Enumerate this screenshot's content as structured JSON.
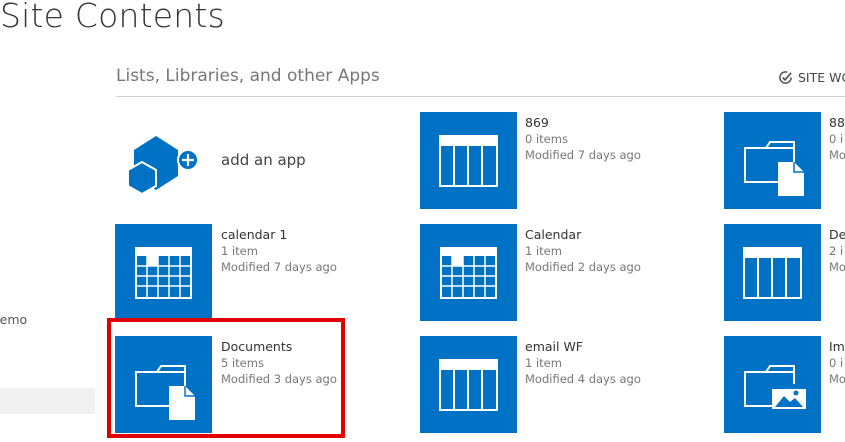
{
  "page_title": "Site Contents",
  "section": {
    "heading": "Lists, Libraries, and other Apps",
    "workflows_label": "SITE WC"
  },
  "sidebar": {
    "item_label": "Demo"
  },
  "add_app": {
    "label": "add an app"
  },
  "apps": [
    {
      "name": "calendar 1",
      "count": "1 item",
      "modified": "Modified 7 days ago",
      "icon": "calendar-icon"
    },
    {
      "name": "Documents",
      "count": "5 items",
      "modified": "Modified 3 days ago",
      "icon": "document-library-icon"
    },
    {
      "name": "869",
      "count": "0 items",
      "modified": "Modified 7 days ago",
      "icon": "list-icon"
    },
    {
      "name": "Calendar",
      "count": "1 item",
      "modified": "Modified 2 days ago",
      "icon": "calendar-icon"
    },
    {
      "name": "email WF",
      "count": "1 item",
      "modified": "Modified 4 days ago",
      "icon": "list-icon"
    },
    {
      "name": "88",
      "count": "0 i",
      "modified": "Mo",
      "icon": "document-library-icon"
    },
    {
      "name": "De",
      "count": "2 i",
      "modified": "Mo",
      "icon": "list-icon"
    },
    {
      "name": "Im",
      "count": "0 i",
      "modified": "Mo",
      "icon": "picture-library-icon"
    }
  ],
  "colors": {
    "tile": "#0072c6",
    "highlight": "#e00000"
  }
}
